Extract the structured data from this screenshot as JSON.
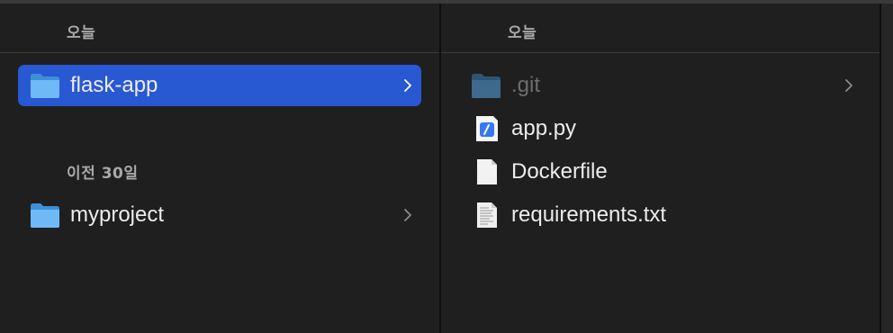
{
  "left_column": {
    "sections": [
      {
        "header": "오늘"
      },
      {
        "header": "이전 30일"
      }
    ],
    "items": [
      {
        "label": "flask-app",
        "icon": "folder-icon",
        "selected": true
      },
      {
        "label": "myproject",
        "icon": "folder-icon",
        "selected": false
      }
    ]
  },
  "right_column": {
    "header": "오늘",
    "items": [
      {
        "label": ".git",
        "icon": "folder-icon",
        "dimmed": true
      },
      {
        "label": "app.py",
        "icon": "python-file-icon"
      },
      {
        "label": "Dockerfile",
        "icon": "document-icon"
      },
      {
        "label": "requirements.txt",
        "icon": "text-file-icon"
      }
    ]
  },
  "colors": {
    "selection": "#2859d3",
    "background": "#1f1f1f",
    "folder": "#5aa9f0"
  }
}
